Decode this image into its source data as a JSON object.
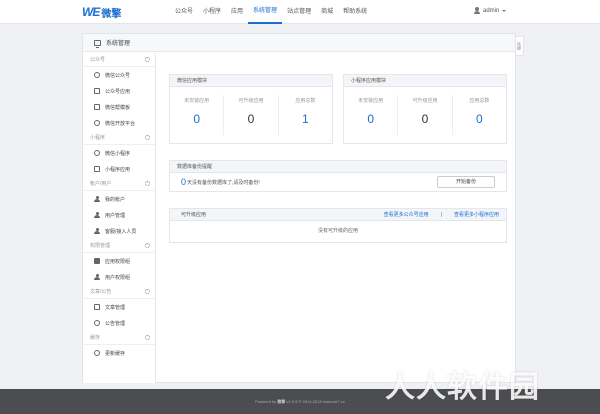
{
  "brand": {
    "logo_mark": "WE",
    "logo_text": "微擎"
  },
  "nav": [
    {
      "label": "公众号",
      "active": false
    },
    {
      "label": "小程序",
      "active": false
    },
    {
      "label": "应用",
      "active": false
    },
    {
      "label": "系统管理",
      "active": true
    },
    {
      "label": "站点管理",
      "active": false
    },
    {
      "label": "商城",
      "active": false
    },
    {
      "label": "帮助系统",
      "active": false
    }
  ],
  "user": {
    "name": "admin"
  },
  "side_tab": "快捷",
  "panel": {
    "title": "系统管理"
  },
  "sidebar": {
    "sections": [
      {
        "title": "公众号",
        "items": [
          {
            "label": "微信公众号",
            "icon": "wechat-icon"
          },
          {
            "label": "公众号应用",
            "icon": "app-icon"
          },
          {
            "label": "微信帮模板",
            "icon": "template-icon"
          },
          {
            "label": "微信开放平台",
            "icon": "platform-icon"
          }
        ]
      },
      {
        "title": "小程序",
        "items": [
          {
            "label": "微信小程序",
            "icon": "miniapp-icon"
          },
          {
            "label": "小程序应用",
            "icon": "miniapp-app-icon"
          }
        ]
      },
      {
        "title": "帐户/用户",
        "items": [
          {
            "label": "我的帐户",
            "icon": "user-icon"
          },
          {
            "label": "用户管理",
            "icon": "users-icon"
          },
          {
            "label": "客服/接入人员",
            "icon": "support-icon"
          }
        ]
      },
      {
        "title": "权限管理",
        "items": [
          {
            "label": "应用权限组",
            "icon": "group-icon"
          },
          {
            "label": "用户权限组",
            "icon": "user-group-icon"
          }
        ]
      },
      {
        "title": "文章/公告",
        "items": [
          {
            "label": "文章管理",
            "icon": "article-icon"
          },
          {
            "label": "公告管理",
            "icon": "notice-icon"
          }
        ]
      },
      {
        "title": "缓存",
        "items": [
          {
            "label": "更新缓存",
            "icon": "refresh-icon"
          }
        ]
      }
    ]
  },
  "wechat_card": {
    "title": "微信应用模块",
    "stats": [
      {
        "label": "未安装应用",
        "value": "0"
      },
      {
        "label": "可升级应用",
        "value": "0"
      },
      {
        "label": "应用总数",
        "value": "1"
      }
    ]
  },
  "miniapp_card": {
    "title": "小程序应用模块",
    "stats": [
      {
        "label": "未安装应用",
        "value": "0"
      },
      {
        "label": "可升级应用",
        "value": "0"
      },
      {
        "label": "应用总数",
        "value": "0"
      }
    ]
  },
  "backup_card": {
    "title": "数据库备份提醒",
    "count": "0",
    "unit": "天",
    "message": "没有备份数据库了,请及时备份!",
    "button": "开始备份"
  },
  "upgrade_card": {
    "title": "可升级应用",
    "link_official": "查看更多公众号应用",
    "separator": "|",
    "link_miniapp": "查看更多小程序应用",
    "empty": "没有可升级的应用"
  },
  "footer": {
    "prefix": "Powered by",
    "brand": "微擎",
    "rest": "v1.5.9 © 2014-2015 www.we7.cc"
  },
  "watermark": "人人软件园"
}
